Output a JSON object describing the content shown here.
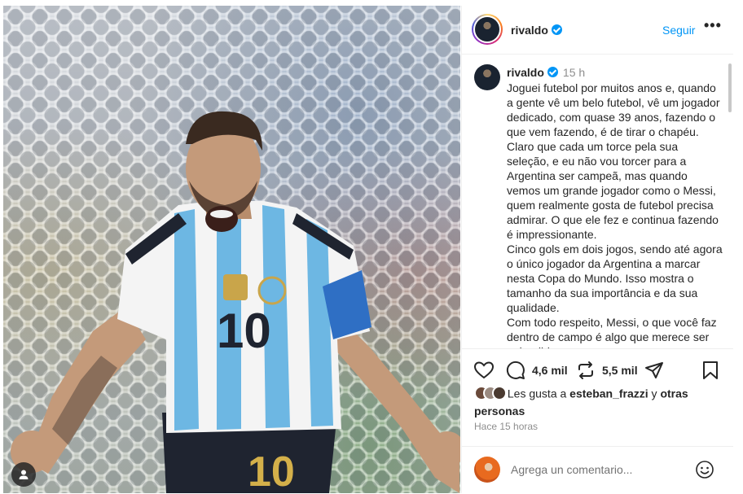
{
  "post": {
    "username": "rivaldo",
    "follow_label": "Seguir",
    "more_label": "•••",
    "time_ago_short": "15 h",
    "caption": [
      "Joguei futebol por muitos anos e, quando a gente vê um belo futebol, vê um jogador dedicado, com quase 39 anos, fazendo o que vem fazendo, é de tirar o chapéu.",
      "Claro que cada um torce pela sua seleção, e eu não vou torcer para a Argentina ser campeã, mas quando vemos um grande jogador como o Messi, quem realmente gosta de futebol precisa admirar. O que ele fez e continua fazendo é impressionante.",
      "Cinco gols em dois jogos, sendo até agora o único jogador da Argentina a marcar nesta Copa do Mundo. Isso mostra o tamanho da sua importância e da sua qualidade.",
      "Com todo respeito, Messi, o que você faz dentro de campo é algo que merece ser aplaudido."
    ],
    "comments_count": "4,6 mil",
    "reposts_count": "5,5 mil",
    "likes_prefix": "Les gusta a",
    "likes_user": "esteban_frazzi",
    "likes_suffix": "y",
    "likes_others": "otras personas",
    "time_ago_long": "Hace 15 horas",
    "comment_placeholder": "Agrega un comentario...",
    "jersey_number": "10"
  },
  "icons": {
    "verified": "verified-badge-icon",
    "like": "heart-icon",
    "comment": "comment-bubble-icon",
    "repost": "repost-icon",
    "share": "send-icon",
    "save": "bookmark-icon",
    "emoji": "smiley-icon",
    "tagged": "user-tag-icon"
  },
  "colors": {
    "accent": "#0095f6",
    "text": "#262626",
    "muted": "#8e8e8e"
  }
}
